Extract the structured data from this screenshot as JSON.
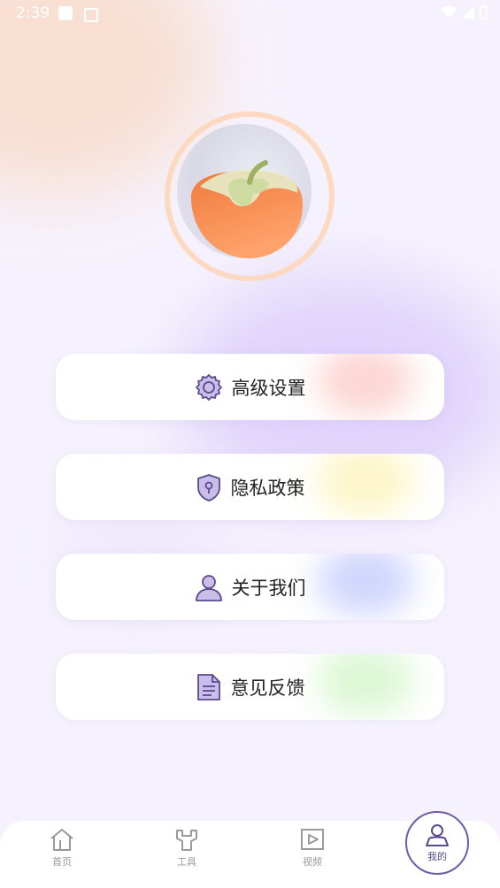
{
  "status_bar": {
    "time": "2:39"
  },
  "menu": [
    {
      "id": "advanced",
      "label": "高级设置",
      "icon": "gear-icon",
      "glow": "#f9b4b0"
    },
    {
      "id": "privacy",
      "label": "隐私政策",
      "icon": "shield-lock-icon",
      "glow": "#fbef9c"
    },
    {
      "id": "about",
      "label": "关于我们",
      "icon": "person-icon",
      "glow": "#aab4fb"
    },
    {
      "id": "feedback",
      "label": "意见反馈",
      "icon": "document-icon",
      "glow": "#bff2b0"
    }
  ],
  "tabbar": {
    "home": {
      "label": "首页",
      "icon": "home-icon"
    },
    "tools": {
      "label": "工具",
      "icon": "wrench-icon"
    },
    "video": {
      "label": "视频",
      "icon": "play-icon"
    },
    "mine": {
      "label": "我的",
      "icon": "user-icon",
      "active": true
    }
  },
  "colors": {
    "accent": "#6f5aa6",
    "tab_inactive": "#9a9a9a",
    "ring": "#fcd9c0"
  }
}
